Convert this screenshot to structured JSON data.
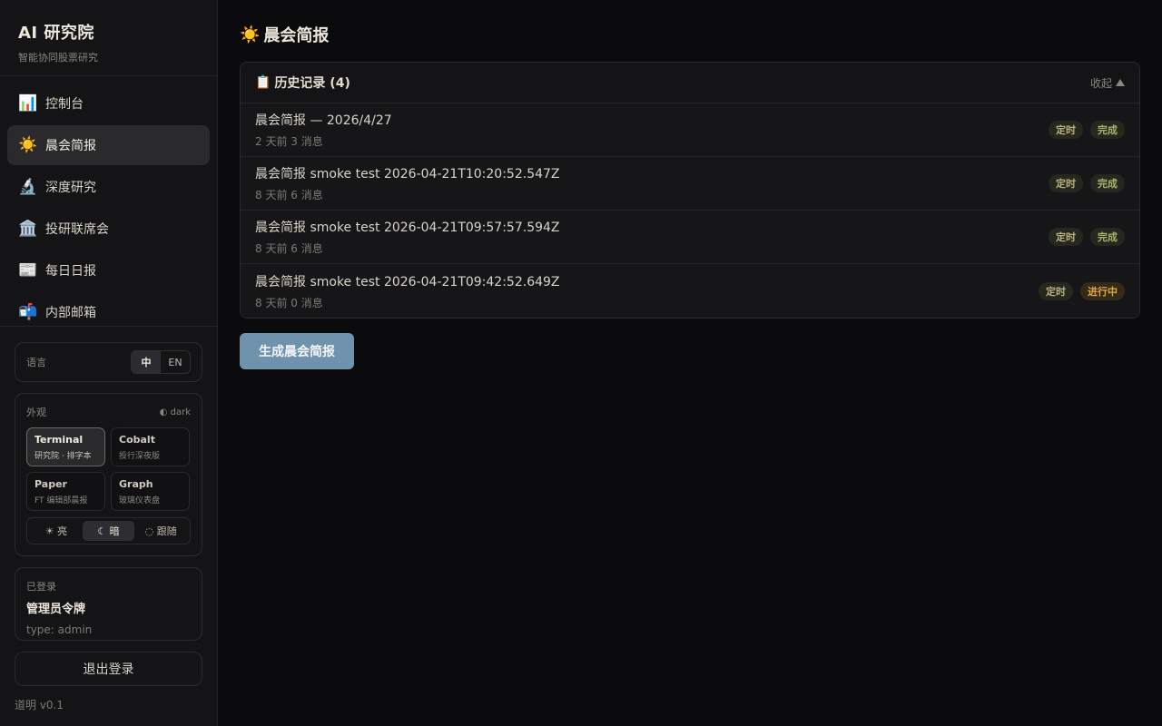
{
  "brand": {
    "title": "AI 研究院",
    "subtitle": "智能协同股票研究"
  },
  "nav": [
    {
      "icon": "📊",
      "label": "控制台"
    },
    {
      "icon": "☀️",
      "label": "晨会简报",
      "active": true
    },
    {
      "icon": "🔬",
      "label": "深度研究"
    },
    {
      "icon": "🏛️",
      "label": "投研联席会"
    },
    {
      "icon": "📰",
      "label": "每日日报"
    },
    {
      "icon": "📬",
      "label": "内部邮箱"
    }
  ],
  "language": {
    "label": "语言",
    "options": [
      "中",
      "EN"
    ],
    "selected": "中"
  },
  "appearance": {
    "label": "外观",
    "mode_tag": "◐ dark",
    "themes": [
      {
        "name": "Terminal",
        "desc": "研究院 · 排字本",
        "selected": true
      },
      {
        "name": "Cobalt",
        "desc": "投行深夜版"
      },
      {
        "name": "Paper",
        "desc": "FT 编辑部晨报"
      },
      {
        "name": "Graph",
        "desc": "玻璃仪表盘"
      }
    ],
    "modes": [
      "☀ 亮",
      "☾ 暗",
      "◌ 跟随"
    ],
    "mode_selected": "☾ 暗"
  },
  "user": {
    "status": "已登录",
    "name": "管理员令牌",
    "type": "type: admin"
  },
  "logout_label": "退出登录",
  "version": "道明 v0.1",
  "page": {
    "icon": "☀️",
    "title": "晨会简报"
  },
  "history": {
    "icon": "📋",
    "title": "历史记录 (4)",
    "collapse_label": "收起",
    "rows": [
      {
        "title": "晨会简报 — 2026/4/27",
        "meta": "2 天前  3 消息",
        "badges": [
          "定时",
          "完成"
        ]
      },
      {
        "title": "晨会简报 smoke test 2026-04-21T10:20:52.547Z",
        "meta": "8 天前  6 消息",
        "badges": [
          "定时",
          "完成"
        ]
      },
      {
        "title": "晨会简报 smoke test 2026-04-21T09:57:57.594Z",
        "meta": "8 天前  6 消息",
        "badges": [
          "定时",
          "完成"
        ]
      },
      {
        "title": "晨会简报 smoke test 2026-04-21T09:42:52.649Z",
        "meta": "8 天前  0 消息",
        "badges": [
          "定时",
          "进行中"
        ]
      }
    ]
  },
  "generate_button": "生成晨会简报",
  "colors": {
    "accent": "#6f93ad",
    "running": "#e0a84a",
    "done": "#a9b46c"
  }
}
